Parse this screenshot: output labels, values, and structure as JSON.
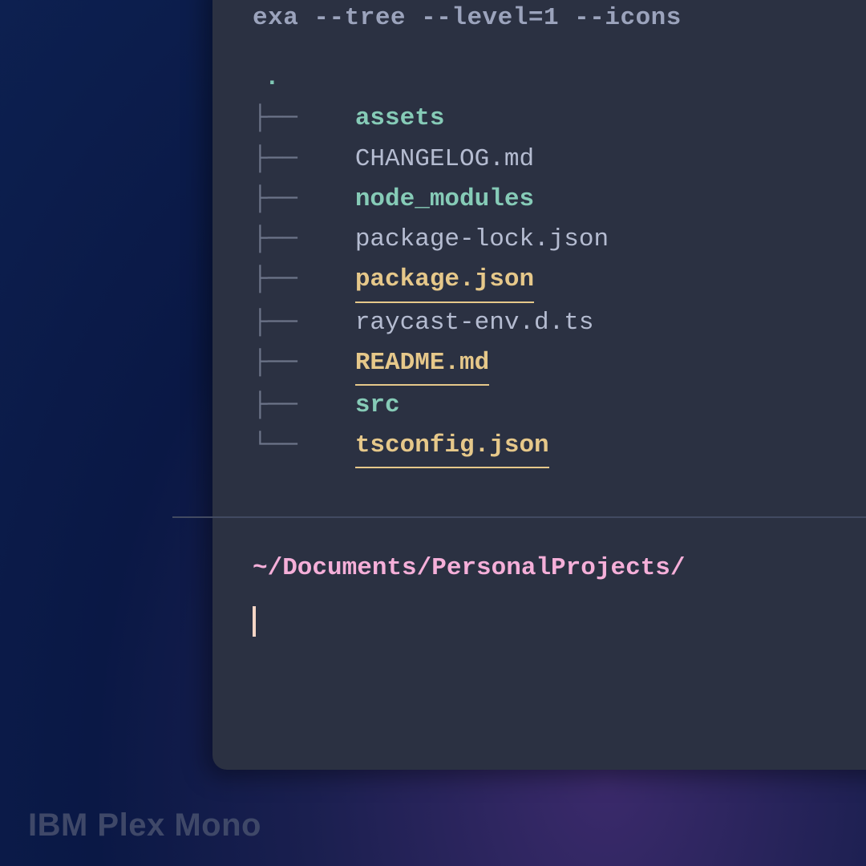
{
  "command": "exa --tree --level=1 --icons",
  "tree": {
    "root": ".",
    "items": [
      {
        "prefix": "├──",
        "name": "assets",
        "type": "dir"
      },
      {
        "prefix": "├──",
        "name": "CHANGELOG.md",
        "type": "file"
      },
      {
        "prefix": "├──",
        "name": "node_modules",
        "type": "dir"
      },
      {
        "prefix": "├──",
        "name": "package-lock.json",
        "type": "file"
      },
      {
        "prefix": "├──",
        "name": "package.json",
        "type": "highlight"
      },
      {
        "prefix": "├──",
        "name": "raycast-env.d.ts",
        "type": "file"
      },
      {
        "prefix": "├──",
        "name": "README.md",
        "type": "highlight"
      },
      {
        "prefix": "├──",
        "name": "src",
        "type": "dir"
      },
      {
        "prefix": "└──",
        "name": "tsconfig.json",
        "type": "highlight"
      }
    ]
  },
  "prompt": {
    "path": "~/Documents/PersonalProjects/"
  },
  "fontLabel": "IBM Plex Mono"
}
